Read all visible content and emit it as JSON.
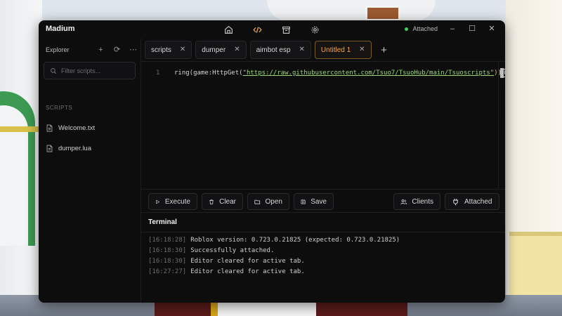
{
  "app": {
    "title": "Madium",
    "status": "Attached",
    "status_color": "#3ecf5a",
    "accent_color": "#f0a64a",
    "nav_icons": [
      "home-icon",
      "code-icon",
      "store-icon",
      "gear-icon"
    ],
    "window_controls": {
      "minimize": "–",
      "maximize": "☐",
      "close": "✕"
    }
  },
  "sidebar": {
    "title": "Explorer",
    "actions": {
      "add": "+",
      "refresh": "⟳",
      "more": "⋯"
    },
    "search_placeholder": "Filter scripts...",
    "section_label": "SCRIPTS",
    "files": [
      {
        "name": "Welcome.txt",
        "icon": "file-icon"
      },
      {
        "name": "dumper.lua",
        "icon": "file-icon"
      }
    ]
  },
  "tabs": [
    {
      "label": "scripts",
      "close": "✕",
      "active": false
    },
    {
      "label": "dumper",
      "close": "✕",
      "active": false
    },
    {
      "label": "aimbot esp",
      "close": "✕",
      "active": false
    },
    {
      "label": "Untitled 1",
      "close": "✕",
      "active": true
    }
  ],
  "tab_add": "+",
  "editor": {
    "line_number": "1",
    "code_prefix": "ring(game:HttpGet(",
    "code_string": "\"https://raw.githubusercontent.com/Tsuo7/TsuoHub/main/Tsuoscripts\"",
    "code_suffix": "))",
    "code_cursor": "()"
  },
  "toolbar": {
    "execute": "Execute",
    "clear": "Clear",
    "open": "Open",
    "save": "Save",
    "clients": "Clients",
    "attached": "Attached"
  },
  "terminal": {
    "title": "Terminal",
    "lines": [
      {
        "ts": "[16:18:28]",
        "msg": "Roblox version: 0.723.0.21825 (expected: 0.723.0.21825)"
      },
      {
        "ts": "[16:18:30]",
        "msg": "Successfully attached."
      },
      {
        "ts": "[16:18:30]",
        "msg": "Editor cleared for active tab."
      },
      {
        "ts": "[16:27:27]",
        "msg": "Editor cleared for active tab."
      }
    ]
  }
}
